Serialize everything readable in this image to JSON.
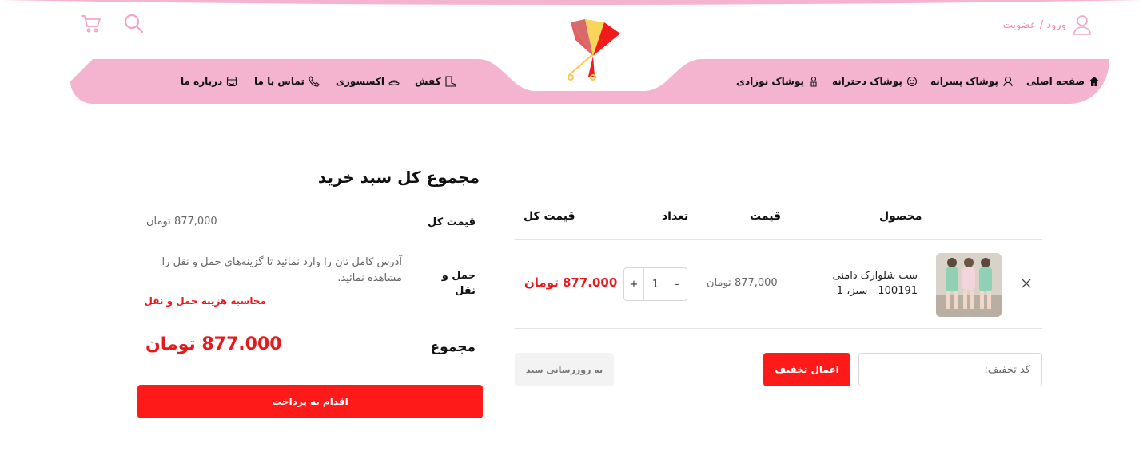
{
  "header": {
    "login_label": "ورود / عضویت",
    "icons": [
      "cart-icon",
      "search-icon",
      "user-icon",
      "logo-pinwheel"
    ],
    "pink": "#f4b4cf",
    "accent_pink": "#f08bb3"
  },
  "nav": {
    "items": [
      {
        "label": "صفحه اصلی",
        "icon": "home-icon"
      },
      {
        "label": "پوشاک پسرانه",
        "icon": "boy-icon"
      },
      {
        "label": "پوشاک دخترانه",
        "icon": "girl-icon"
      },
      {
        "label": "پوشاک نوزادی",
        "icon": "baby-icon"
      },
      {
        "label": "کفش",
        "icon": "boot-icon"
      },
      {
        "label": "اکسسوری",
        "icon": "hat-icon"
      },
      {
        "label": "تماس با ما",
        "icon": "phone-icon"
      },
      {
        "label": "درباره ما",
        "icon": "store-icon"
      }
    ]
  },
  "cart": {
    "headers": {
      "product": "محصول",
      "price": "قیمت",
      "quantity": "تعداد",
      "total": "قیمت کل"
    },
    "items": [
      {
        "name": "ست شلوارک دامنی 100191 - سبز، 1",
        "price": "877,000 تومان",
        "quantity": "1",
        "total": "877.000 تومان"
      }
    ],
    "qty_minus": "-",
    "qty_plus": "+",
    "coupon_placeholder": "کد تخفیف:",
    "apply_label": "اعمال تخفیف",
    "update_label": "به روزرسانی سبد"
  },
  "totals": {
    "title": "مجموع کل سبد خرید",
    "subtotal_label": "قیمت کل",
    "subtotal_value": "877,000 تومان",
    "shipping_label": "حمل و نقل",
    "shipping_note": "آدرس کامل تان را وارد نمائید تا گزینه‌های حمل و نقل را مشاهده نمائید.",
    "shipping_calc": "محاسبه هزینه حمل و نقل",
    "total_label": "مجموع",
    "total_value": "877.000 تومان",
    "checkout_label": "اقدام به پرداخت"
  },
  "colors": {
    "primary_red": "#ff1a1a",
    "price_red": "#e8191b"
  }
}
